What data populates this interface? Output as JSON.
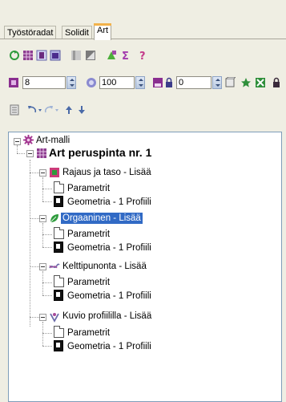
{
  "tabs": [
    {
      "label": "Työstöradat",
      "active": false
    },
    {
      "label": "Solidit",
      "active": false
    },
    {
      "label": "Art",
      "active": true
    }
  ],
  "toolbar2": {
    "field1_value": "8",
    "field2_value": "100",
    "field3_value": "0"
  },
  "tree": {
    "root": "Art-malli",
    "surface": "Art peruspinta nr. 1",
    "groups": [
      {
        "label": "Rajaus ja taso - Lisää",
        "params": "Parametrit",
        "geometry": "Geometria - 1 Profiili"
      },
      {
        "label": "Orgaaninen - Lisää",
        "params": "Parametrit",
        "geometry": "Geometria - 1 Profiili",
        "selected": true
      },
      {
        "label": "Kelttipunonta - Lisää",
        "params": "Parametrit",
        "geometry": "Geometria - 1 Profiili"
      },
      {
        "label": "Kuvio profiililla - Lisää",
        "params": "Parametrit",
        "geometry": "Geometria - 1 Profiili"
      }
    ]
  },
  "colors": {
    "selection": "#316ac5",
    "tab_accent": "#f2b24b",
    "panel_bg": "#efeee3"
  }
}
